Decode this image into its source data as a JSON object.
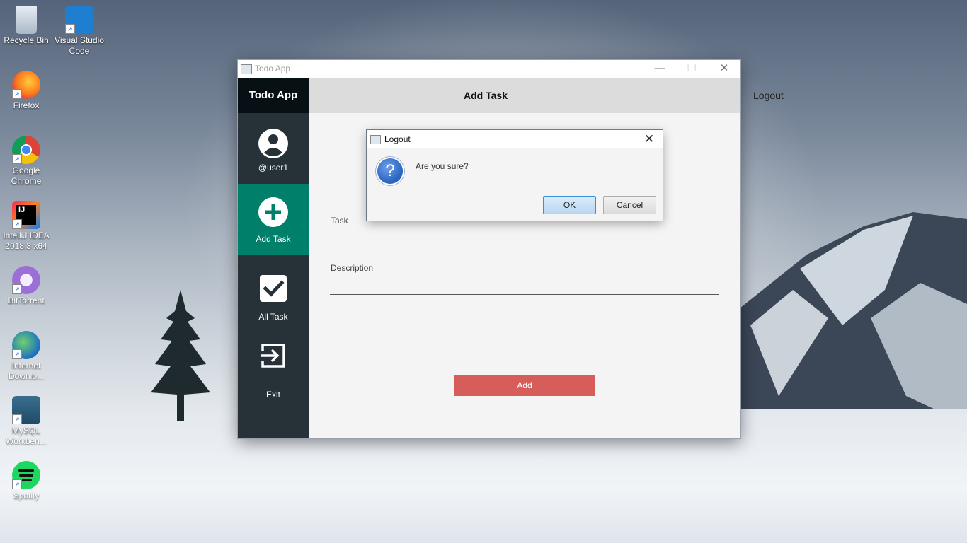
{
  "desktop": {
    "icons": [
      {
        "label": "Recycle Bin"
      },
      {
        "label": "Visual Studio Code"
      },
      {
        "label": "Firefox"
      },
      {
        "label": "Google Chrome"
      },
      {
        "label": "IntelliJ IDEA 2018.3 x64"
      },
      {
        "label": "BitTorrent"
      },
      {
        "label": "Internet Downlo..."
      },
      {
        "label": "MySQL Workben..."
      },
      {
        "label": "Spotify"
      }
    ]
  },
  "window": {
    "title": "Todo App",
    "minimize": "—",
    "maximize": "☐",
    "close": "✕"
  },
  "sidebar": {
    "brand": "Todo App",
    "items": [
      {
        "label": "@user1",
        "icon": "user-icon"
      },
      {
        "label": "Add Task",
        "icon": "plus-circle-icon"
      },
      {
        "label": "All Task",
        "icon": "checkbox-icon"
      },
      {
        "label": "Exit",
        "icon": "exit-icon"
      }
    ]
  },
  "header": {
    "title": "Add Task",
    "logout": "Logout"
  },
  "form": {
    "task_label": "Task",
    "description_label": "Description",
    "add_button": "Add"
  },
  "dialog": {
    "title": "Logout",
    "close": "✕",
    "message": "Are you sure?",
    "ok": "OK",
    "cancel": "Cancel"
  },
  "colors": {
    "sidebar": "#263238",
    "active": "#00806b",
    "add_button": "#d75d5a"
  }
}
